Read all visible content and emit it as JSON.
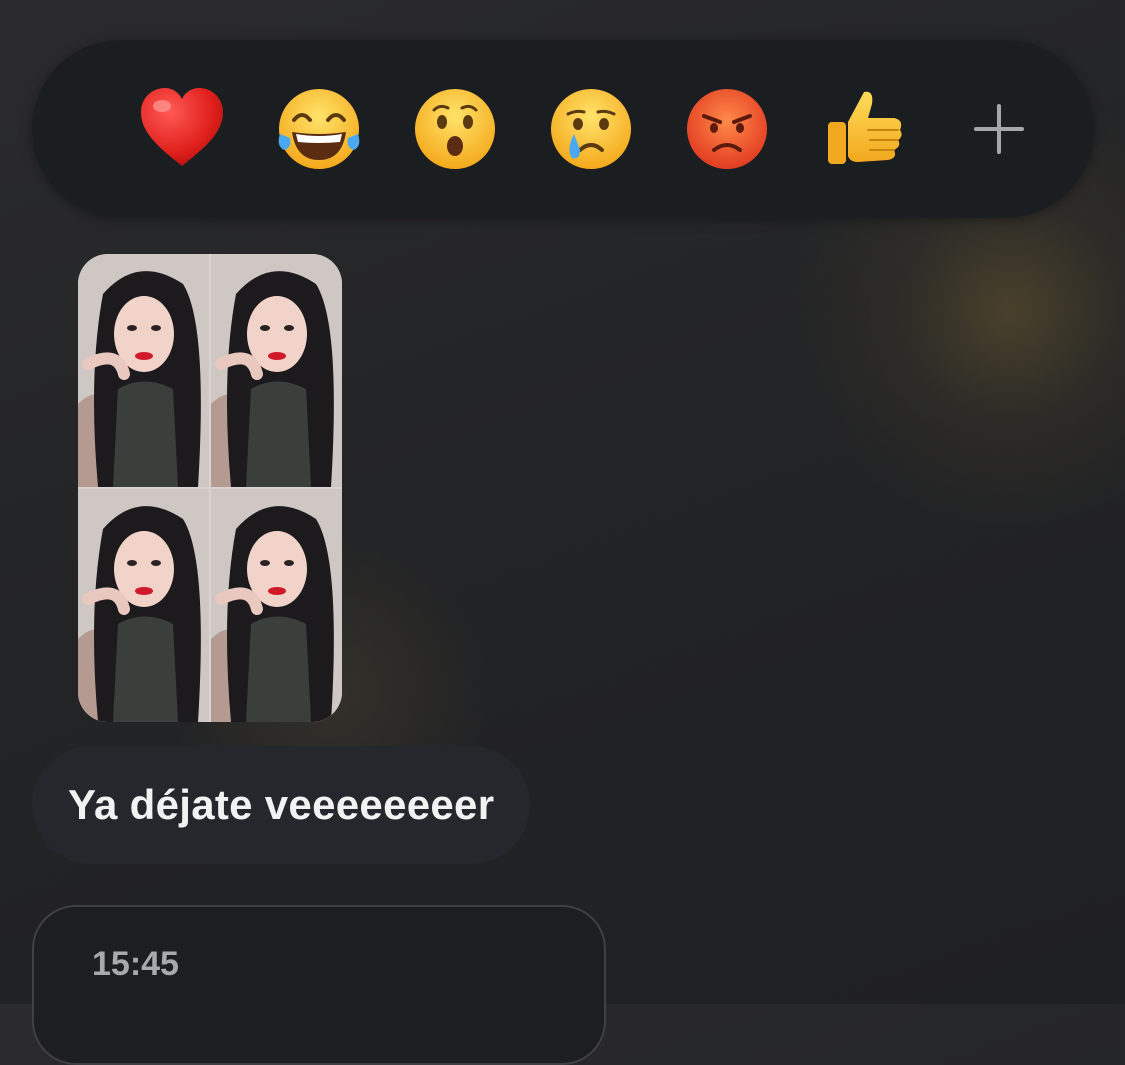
{
  "reactions": [
    {
      "name": "heart",
      "icon": "red-heart-icon"
    },
    {
      "name": "laugh",
      "icon": "tears-of-joy-icon"
    },
    {
      "name": "wow",
      "icon": "surprised-face-icon"
    },
    {
      "name": "sad",
      "icon": "crying-face-icon"
    },
    {
      "name": "angry",
      "icon": "angry-face-icon"
    },
    {
      "name": "like",
      "icon": "thumbs-up-icon"
    },
    {
      "name": "more",
      "icon": "plus-icon"
    }
  ],
  "photo_message": {
    "tiles": 4
  },
  "text_message": {
    "text": "Ya déjate veeeeeeeer"
  },
  "time_bubble": {
    "time": "15:45"
  },
  "colors": {
    "reaction_bar_bg": "#1b1e21",
    "bubble_bg": "#24272b",
    "text": "#f2f2f2",
    "time_text": "#a7a9ad"
  }
}
